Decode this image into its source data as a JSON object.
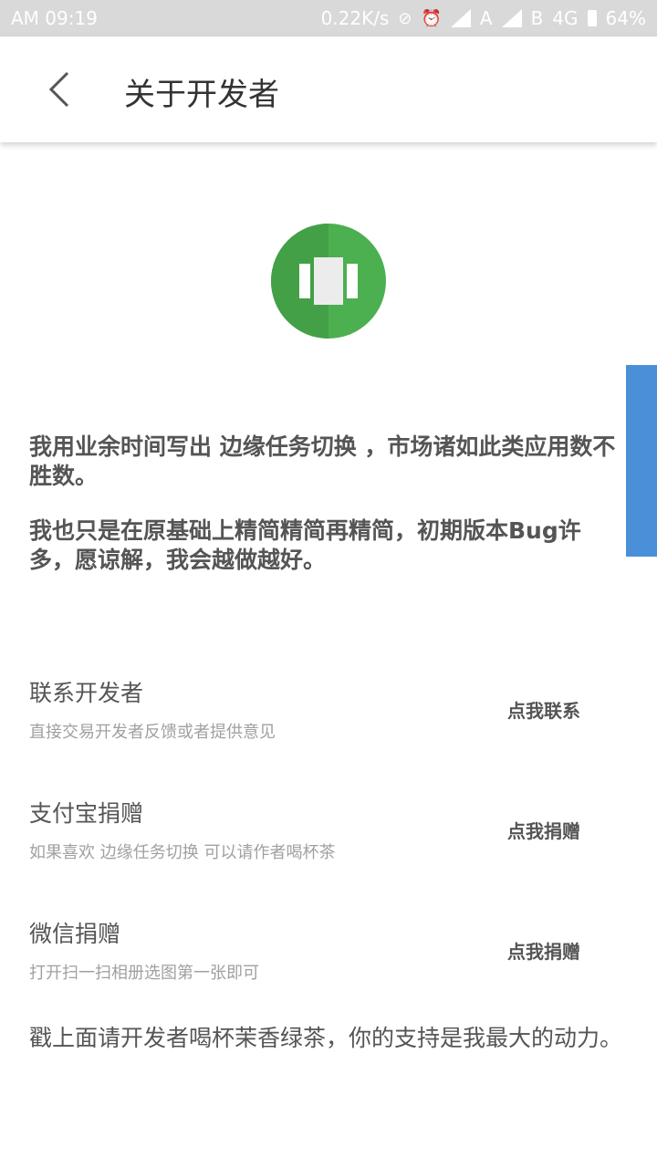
{
  "status_bar": {
    "time": "AM  09:19",
    "speed": "0.22K/s",
    "sim_a": "A",
    "sim_b": "B",
    "network": "4G",
    "battery": "64%"
  },
  "header": {
    "title": "关于开发者"
  },
  "intro": {
    "paragraph1": "我用业余时间写出 边缘任务切换 ，市场诸如此类应用数不胜数。",
    "paragraph2": "我也只是在原基础上精简精简再精简，初期版本Bug许多，愿谅解，我会越做越好。"
  },
  "rows": [
    {
      "title": "联系开发者",
      "subtitle": "直接交易开发者反馈或者提供意见",
      "action": "点我联系"
    },
    {
      "title": "支付宝捐赠",
      "subtitle": "如果喜欢 边缘任务切换 可以请作者喝杯茶",
      "action": "点我捐赠"
    },
    {
      "title": "微信捐赠",
      "subtitle": "打开扫一扫相册选图第一张即可",
      "action": "点我捐赠"
    }
  ],
  "footer": {
    "note": "戳上面请开发者喝杯茉香绿茶，你的支持是我最大的动力。"
  },
  "colors": {
    "logo_green": "#4caf50",
    "logo_green_dark": "#43a047",
    "side_tab_blue": "#4a90d9"
  }
}
